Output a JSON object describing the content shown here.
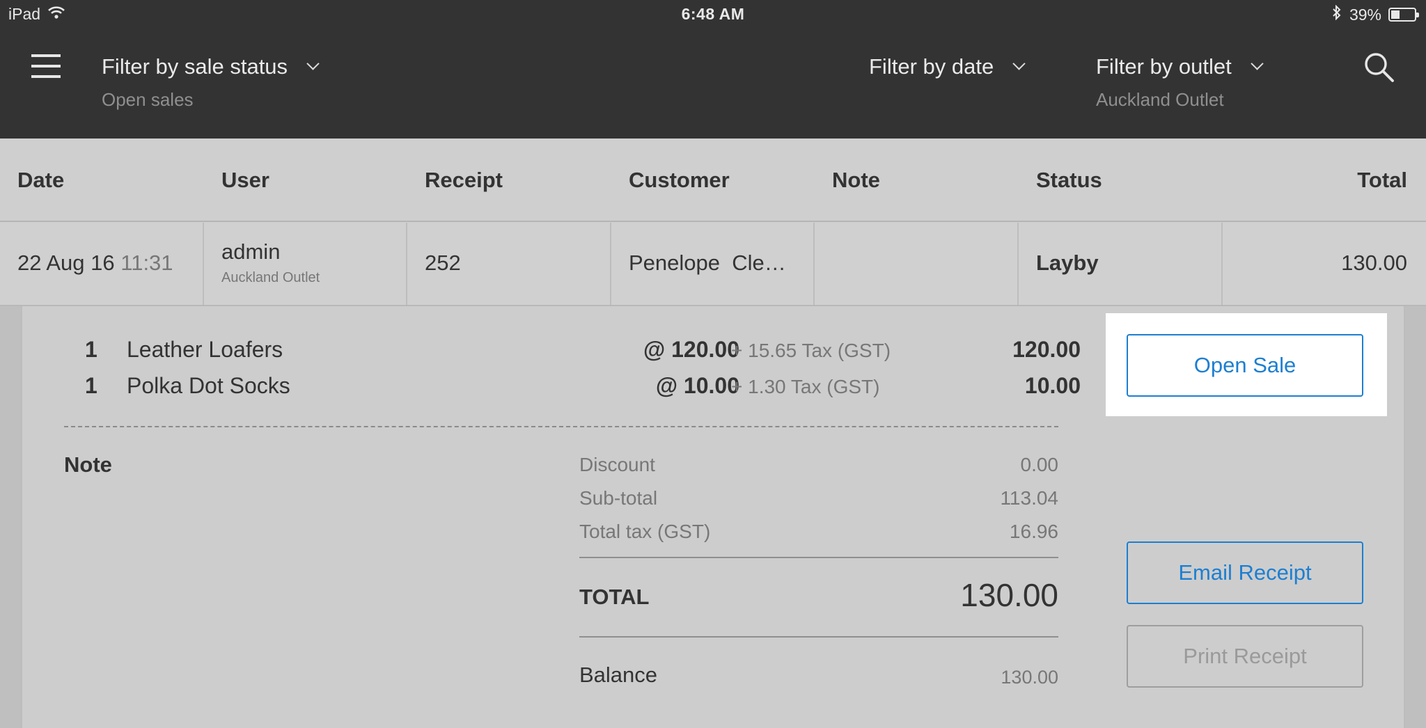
{
  "status_bar": {
    "device": "iPad",
    "time": "6:48 AM",
    "battery": "39%",
    "battery_level": 0.39
  },
  "header": {
    "menu_icon": "hamburger-icon",
    "filters": {
      "status": {
        "label": "Filter by sale status",
        "value": "Open sales"
      },
      "date": {
        "label": "Filter by date",
        "value": ""
      },
      "outlet": {
        "label": "Filter by outlet",
        "value": "Auckland Outlet"
      }
    },
    "search_icon": "search-icon"
  },
  "table": {
    "columns": [
      "Date",
      "User",
      "Receipt",
      "Customer",
      "Note",
      "Status",
      "Total"
    ],
    "row": {
      "date": "22 Aug 16",
      "time": "11:31",
      "user": "admin",
      "user_outlet": "Auckland Outlet",
      "receipt": "252",
      "customer": "Penelope  Cle…",
      "note": "",
      "status": "Layby",
      "total": "130.00"
    }
  },
  "details": {
    "items": [
      {
        "qty": "1",
        "name": "Leather Loafers",
        "price": "@ 120.00",
        "tax": "+ 15.65 Tax (GST)",
        "total": "120.00"
      },
      {
        "qty": "1",
        "name": "Polka Dot Socks",
        "price": "@ 10.00",
        "tax": "+ 1.30 Tax (GST)",
        "total": "10.00"
      }
    ],
    "note_label": "Note",
    "summary": {
      "discount_label": "Discount",
      "discount": "0.00",
      "subtotal_label": "Sub-total",
      "subtotal": "113.04",
      "tax_label": "Total tax (GST)",
      "tax": "16.96",
      "total_label": "TOTAL",
      "total": "130.00",
      "balance_label": "Balance",
      "balance": "130.00"
    },
    "buttons": {
      "open_sale": "Open Sale",
      "email_receipt": "Email Receipt",
      "print_receipt": "Print Receipt"
    }
  },
  "colors": {
    "topbar": "#333333",
    "accent": "#1d7fd1",
    "background": "#cfcfcf"
  }
}
